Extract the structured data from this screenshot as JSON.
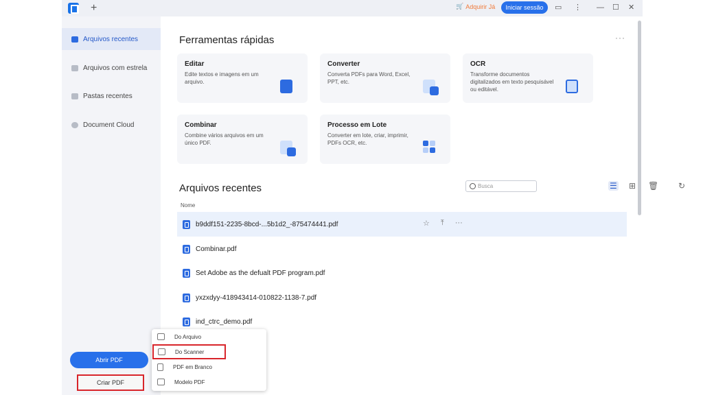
{
  "titlebar": {
    "new_tab": "+",
    "buy_label": "Adquirir Já",
    "login_label": "Iniciar sessão",
    "icons": [
      "cart-icon",
      "chat-icon",
      "kebab-icon",
      "minimize-icon",
      "maximize-icon",
      "close-icon"
    ]
  },
  "sidebar": {
    "items": [
      {
        "label": "Arquivos recentes"
      },
      {
        "label": "Arquivos com estrela"
      },
      {
        "label": "Pastas recentes"
      },
      {
        "label": "Document Cloud"
      }
    ],
    "open_label": "Abrir PDF",
    "create_label": "Criar PDF"
  },
  "tools": {
    "title": "Ferramentas rápidas",
    "more": "···",
    "cards": [
      {
        "title": "Editar",
        "desc": "Edite textos e imagens em um arquivo."
      },
      {
        "title": "Converter",
        "desc": "Converta PDFs para Word, Excel, PPT, etc."
      },
      {
        "title": "OCR",
        "desc": "Transforme documentos digitalizados em texto pesquisável ou editável."
      },
      {
        "title": "Combinar",
        "desc": "Combine vários arquivos em um único PDF."
      },
      {
        "title": "Processo em Lote",
        "desc": "Converter em lote, criar, imprimir, PDFs OCR, etc."
      }
    ]
  },
  "recent": {
    "title": "Arquivos recentes",
    "search_placeholder": "Busca",
    "column_name": "Nome",
    "files": [
      "b9ddf151-2235-8bcd-...5b1d2_-875474441.pdf",
      "Combinar.pdf",
      "Set Adobe as the defualt PDF program.pdf",
      "yxzxdyy-418943414-010822-1138-7.pdf",
      "ind_ctrc_demo.pdf"
    ]
  },
  "create_menu": {
    "items": [
      "Do Arquivo",
      "Do Scanner",
      "PDF em Branco",
      "Modelo PDF"
    ]
  },
  "colors": {
    "accent": "#2870ea",
    "highlight": "#d8242a",
    "buy": "#f07a3a"
  }
}
